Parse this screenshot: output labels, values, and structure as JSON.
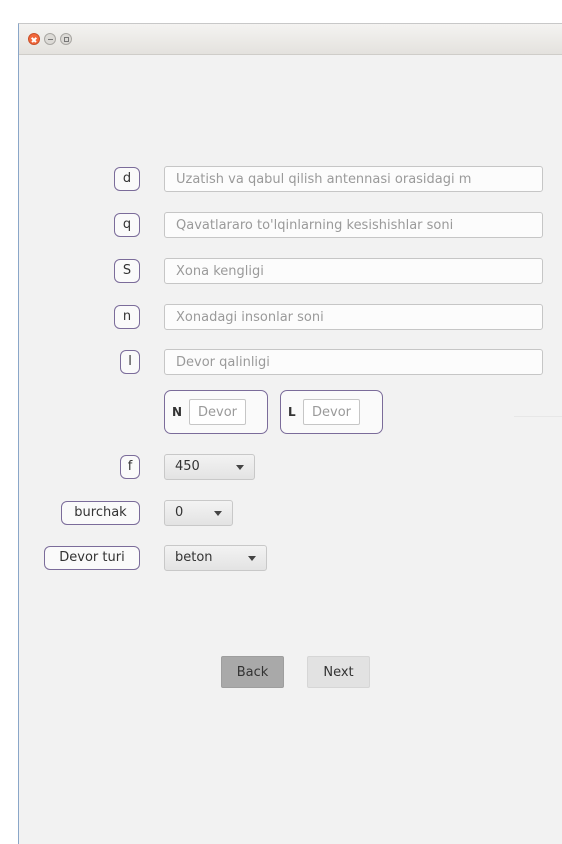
{
  "window": {
    "controls": {
      "close_icon": "close-icon",
      "minimize_icon": "minimize-icon",
      "maximize_icon": "maximize-icon"
    }
  },
  "form": {
    "rows": [
      {
        "label": "d",
        "placeholder": "Uzatish va qabul qilish antennasi orasidagi m",
        "value": ""
      },
      {
        "label": "q",
        "placeholder": "Qavatlararo to'lqinlarning kesishishlar soni",
        "value": ""
      },
      {
        "label": "S",
        "placeholder": "Xona kengligi",
        "value": ""
      },
      {
        "label": "n",
        "placeholder": "Xonadagi insonlar soni",
        "value": ""
      },
      {
        "label": "l",
        "placeholder": "Devor qalinligi",
        "value": ""
      }
    ],
    "wall_pairs": [
      {
        "label": "N",
        "placeholder": "Devor",
        "value": ""
      },
      {
        "label": "L",
        "placeholder": "Devor",
        "value": ""
      }
    ],
    "f": {
      "label": "f",
      "selected": "450"
    },
    "burchak": {
      "label": "burchak",
      "selected": "0"
    },
    "devor_turi": {
      "label": "Devor turi",
      "selected": "beton"
    }
  },
  "buttons": {
    "back": "Back",
    "next": "Next"
  },
  "colors": {
    "label_border": "#7b6c9a",
    "back_button": "#a9a9a9",
    "next_button": "#e2e2e2"
  }
}
